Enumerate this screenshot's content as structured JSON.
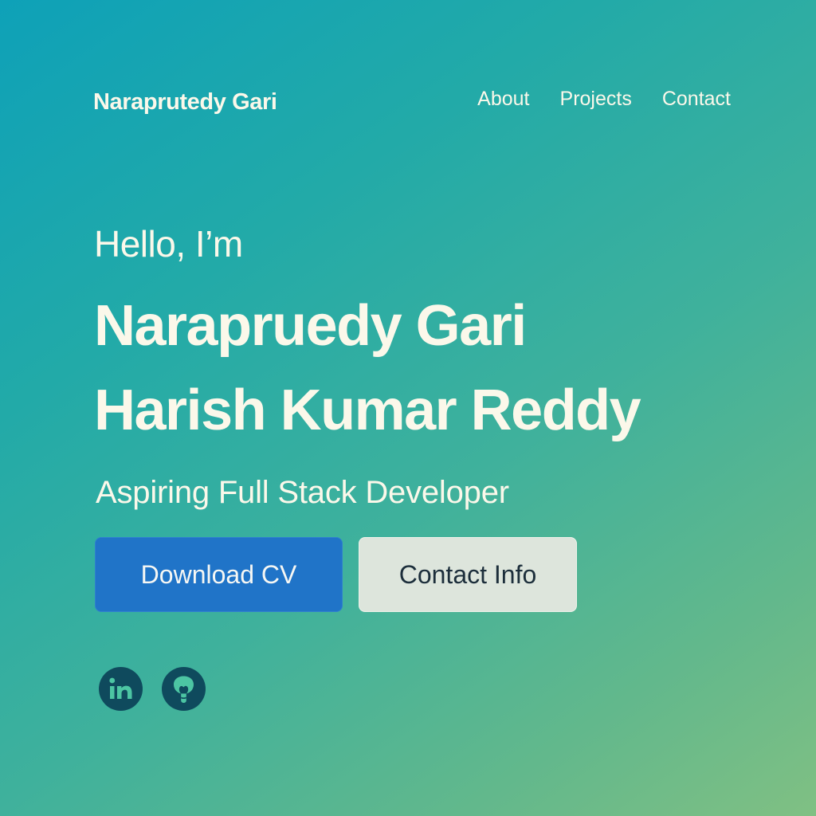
{
  "nav": {
    "brand": "Naraprutedy Gari",
    "links": [
      "About",
      "Projects",
      "Contact"
    ]
  },
  "hero": {
    "greeting": "Hello, I’m",
    "name_line1": "Narapruedy Gari",
    "name_line2": "Harish Kumar Reddy",
    "role": "Aspiring Full Stack Developer"
  },
  "buttons": {
    "primary_label": "Download CV",
    "secondary_label": "Contact Info"
  },
  "socials": {
    "icons": [
      "linkedin-icon",
      "github-icon"
    ]
  },
  "colors": {
    "background_start": "#0ea1b8",
    "background_end": "#80c083",
    "text": "#fbf8ea",
    "primary_button": "#2074c8",
    "secondary_button": "#dde5dc",
    "icon_circle": "#0f4a5d"
  }
}
